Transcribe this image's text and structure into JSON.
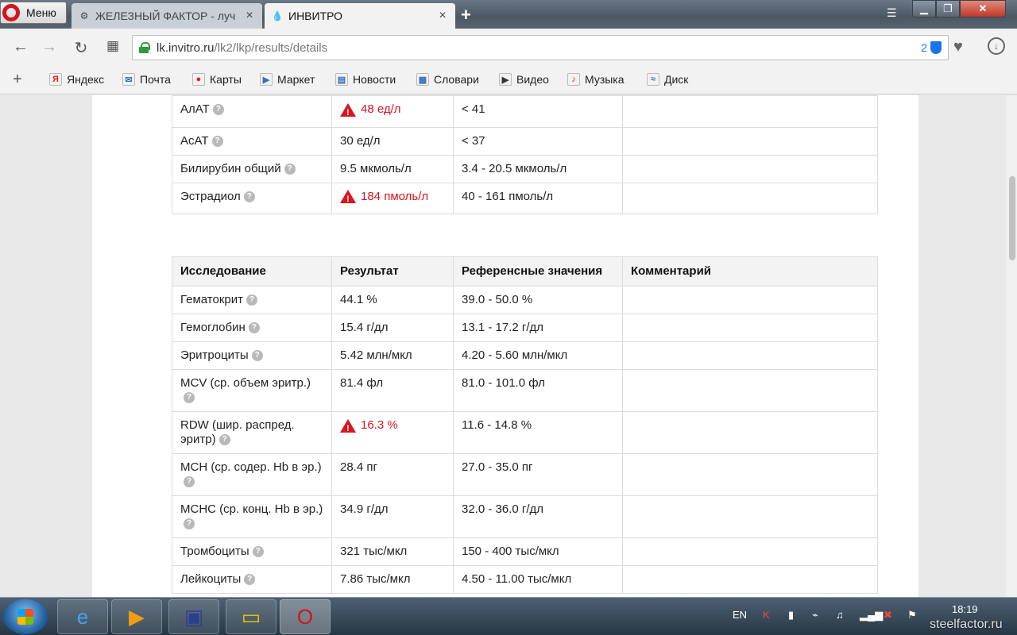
{
  "browser": {
    "menu_label": "Меню",
    "tabs": [
      {
        "title": "ЖЕЛЕЗНЫЙ ФАКТОР - луч",
        "close": "×"
      },
      {
        "title": "ИНВИТРО",
        "close": "×"
      }
    ],
    "new_tab": "+",
    "url_host": "lk.invitro.ru",
    "url_path": "/lk2/lkp/results/details",
    "badge_count": "2"
  },
  "bookmarks": [
    {
      "label": "Яндекс",
      "icon": "yandex-icon",
      "glyph": "Я",
      "color": "#e31e24"
    },
    {
      "label": "Почта",
      "icon": "mail-icon",
      "glyph": "✉",
      "color": "#3b6fb6"
    },
    {
      "label": "Карты",
      "icon": "map-pin-icon",
      "glyph": "●",
      "color": "#e31e24"
    },
    {
      "label": "Маркет",
      "icon": "market-icon",
      "glyph": "▶",
      "color": "#3b6fb6"
    },
    {
      "label": "Новости",
      "icon": "news-icon",
      "glyph": "▤",
      "color": "#3b6fb6"
    },
    {
      "label": "Словари",
      "icon": "dictionary-icon",
      "glyph": "▦",
      "color": "#3b6fb6"
    },
    {
      "label": "Видео",
      "icon": "video-icon",
      "glyph": "▶",
      "color": "#333333"
    },
    {
      "label": "Музыка",
      "icon": "music-icon",
      "glyph": "♪",
      "color": "#e31e24"
    },
    {
      "label": "Диск",
      "icon": "disk-icon",
      "glyph": "≈",
      "color": "#3b6fb6"
    }
  ],
  "table_top": {
    "rows": [
      {
        "name": "АлАТ",
        "result": "48 ед/л",
        "abnormal": true,
        "ref": "< 41",
        "comment": ""
      },
      {
        "name": "АсАТ",
        "result": "30 ед/л",
        "abnormal": false,
        "ref": "< 37",
        "comment": ""
      },
      {
        "name": "Билирубин общий",
        "result": "9.5 мкмоль/л",
        "abnormal": false,
        "ref": "3.4 - 20.5 мкмоль/л",
        "comment": ""
      },
      {
        "name": "Эстрадиол",
        "result": "184 пмоль/л",
        "abnormal": true,
        "ref": "40 - 161 пмоль/л",
        "comment": ""
      }
    ]
  },
  "table_main": {
    "headers": [
      "Исследование",
      "Результат",
      "Референсные значения",
      "Комментарий"
    ],
    "rows": [
      {
        "name": "Гематокрит",
        "result": "44.1 %",
        "abnormal": false,
        "ref": "39.0 - 50.0 %",
        "comment": ""
      },
      {
        "name": "Гемоглобин",
        "result": "15.4 г/дл",
        "abnormal": false,
        "ref": "13.1 - 17.2 г/дл",
        "comment": ""
      },
      {
        "name": "Эритроциты",
        "result": "5.42 млн/мкл",
        "abnormal": false,
        "ref": "4.20 - 5.60 млн/мкл",
        "comment": ""
      },
      {
        "name": "MCV (ср. объем эритр.)",
        "result": "81.4 фл",
        "abnormal": false,
        "ref": "81.0 - 101.0 фл",
        "comment": ""
      },
      {
        "name": "RDW (шир. распред. эритр)",
        "result": "16.3 %",
        "abnormal": true,
        "ref": "11.6 - 14.8 %",
        "comment": ""
      },
      {
        "name": "MCH (ср. содер. Hb в эр.)",
        "result": "28.4 пг",
        "abnormal": false,
        "ref": "27.0 - 35.0 пг",
        "comment": ""
      },
      {
        "name": "MCHC (ср. конц. Hb в эр.)",
        "result": "34.9 г/дл",
        "abnormal": false,
        "ref": "32.0 - 36.0 г/дл",
        "comment": ""
      },
      {
        "name": "Тромбоциты",
        "result": "321 тыс/мкл",
        "abnormal": false,
        "ref": "150 - 400 тыс/мкл",
        "comment": ""
      },
      {
        "name": "Лейкоциты",
        "result": "7.86 тыс/мкл",
        "abnormal": false,
        "ref": "4.50 - 11.00 тыс/мкл",
        "comment": ""
      }
    ]
  },
  "taskbar": {
    "language": "EN",
    "time": "18:19",
    "watermark": "steelfactor.ru",
    "apps": [
      "internet-explorer-icon",
      "media-player-icon",
      "save-disk-icon",
      "file-explorer-icon",
      "opera-icon"
    ]
  },
  "colors": {
    "abnormal": "#d9141e",
    "header_bg": "#f3f3f3",
    "border": "#dcdcdc"
  }
}
